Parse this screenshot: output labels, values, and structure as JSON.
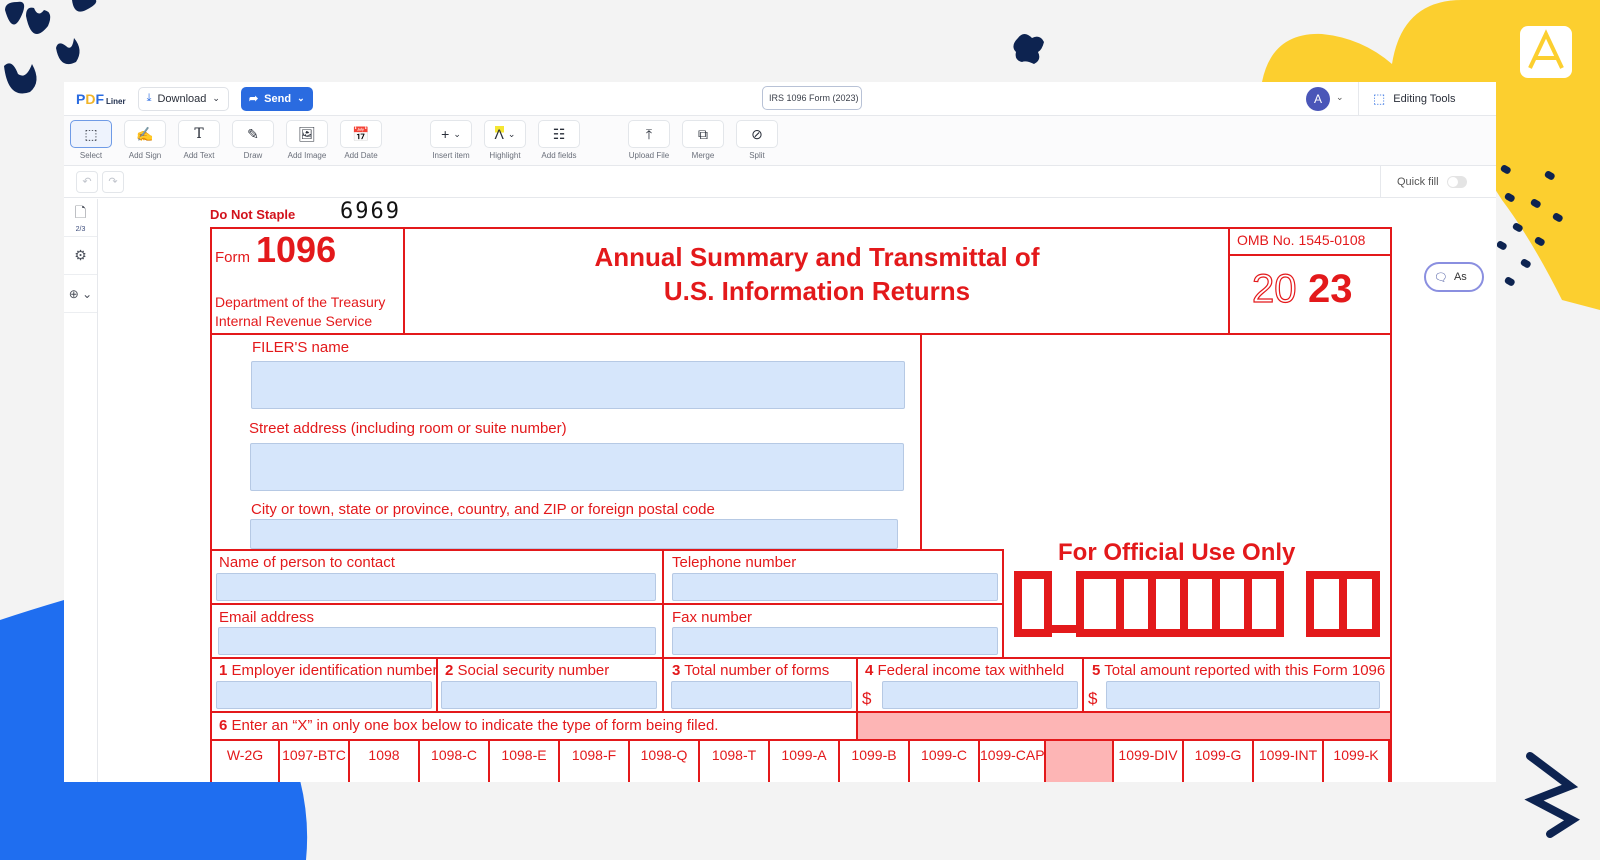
{
  "app": {
    "logo": {
      "p": "P",
      "d": "D",
      "f": "F",
      "liner": "Liner"
    },
    "download_label": "Download",
    "send_label": "Send",
    "document_title": "IRS 1096 Form (2023)",
    "avatar_initial": "A",
    "editing_tools_label": "Editing Tools",
    "brand_color": "#2a6be0"
  },
  "toolbar": {
    "tools": [
      {
        "label": "Select",
        "icon": "select-icon"
      },
      {
        "label": "Add Sign",
        "icon": "sign-icon"
      },
      {
        "label": "Add Text",
        "icon": "text-icon"
      },
      {
        "label": "Draw",
        "icon": "draw-icon"
      },
      {
        "label": "Add Image",
        "icon": "image-icon"
      },
      {
        "label": "Add Date",
        "icon": "calendar-icon"
      },
      {
        "label": "Insert item",
        "icon": "plus-icon"
      },
      {
        "label": "Highlight",
        "icon": "highlight-icon"
      },
      {
        "label": "Add fields",
        "icon": "fields-icon"
      },
      {
        "label": "Upload File",
        "icon": "upload-icon"
      },
      {
        "label": "Merge",
        "icon": "merge-icon"
      },
      {
        "label": "Split",
        "icon": "split-icon"
      }
    ]
  },
  "subbar": {
    "quick_fill_label": "Quick fill",
    "quick_fill_on": false
  },
  "sidebar": {
    "page_indicator": "2/3"
  },
  "ask_button_label": "As",
  "form": {
    "do_not_staple": "Do Not Staple",
    "code": "6969",
    "form_word": "Form",
    "form_number": "1096",
    "dept_line1": "Department of the Treasury",
    "dept_line2": "Internal Revenue Service",
    "title_line1": "Annual Summary and Transmittal of",
    "title_line2": "U.S. Information Returns",
    "omb": "OMB No. 1545-0108",
    "year_outline": "20",
    "year_bold": "23",
    "filers_name": "FILER'S name",
    "street_address": "Street address (including room or suite number)",
    "city": "City or town, state or province, country, and ZIP or foreign postal code",
    "contact_name": "Name of person to contact",
    "telephone": "Telephone number",
    "email": "Email address",
    "fax": "Fax number",
    "official_use": "For Official Use Only",
    "box1_num": "1",
    "box1": "Employer identification number",
    "box2_num": "2",
    "box2": "Social security number",
    "box3_num": "3",
    "box3": "Total number of forms",
    "box4_num": "4",
    "box4": "Federal income tax withheld",
    "box5_num": "5",
    "box5": "Total amount reported with this Form 1096",
    "dollar": "$",
    "box6_num": "6",
    "box6": "Enter an “X” in only one box below to indicate the type of form being filed.",
    "form_types": [
      "W-2G",
      "1097-BTC",
      "1098",
      "1098-C",
      "1098-E",
      "1098-F",
      "1098-Q",
      "1098-T",
      "1099-A",
      "1099-B",
      "1099-C",
      "1099-CAP",
      "",
      "1099-DIV",
      "1099-G",
      "1099-INT",
      "1099-K"
    ]
  }
}
